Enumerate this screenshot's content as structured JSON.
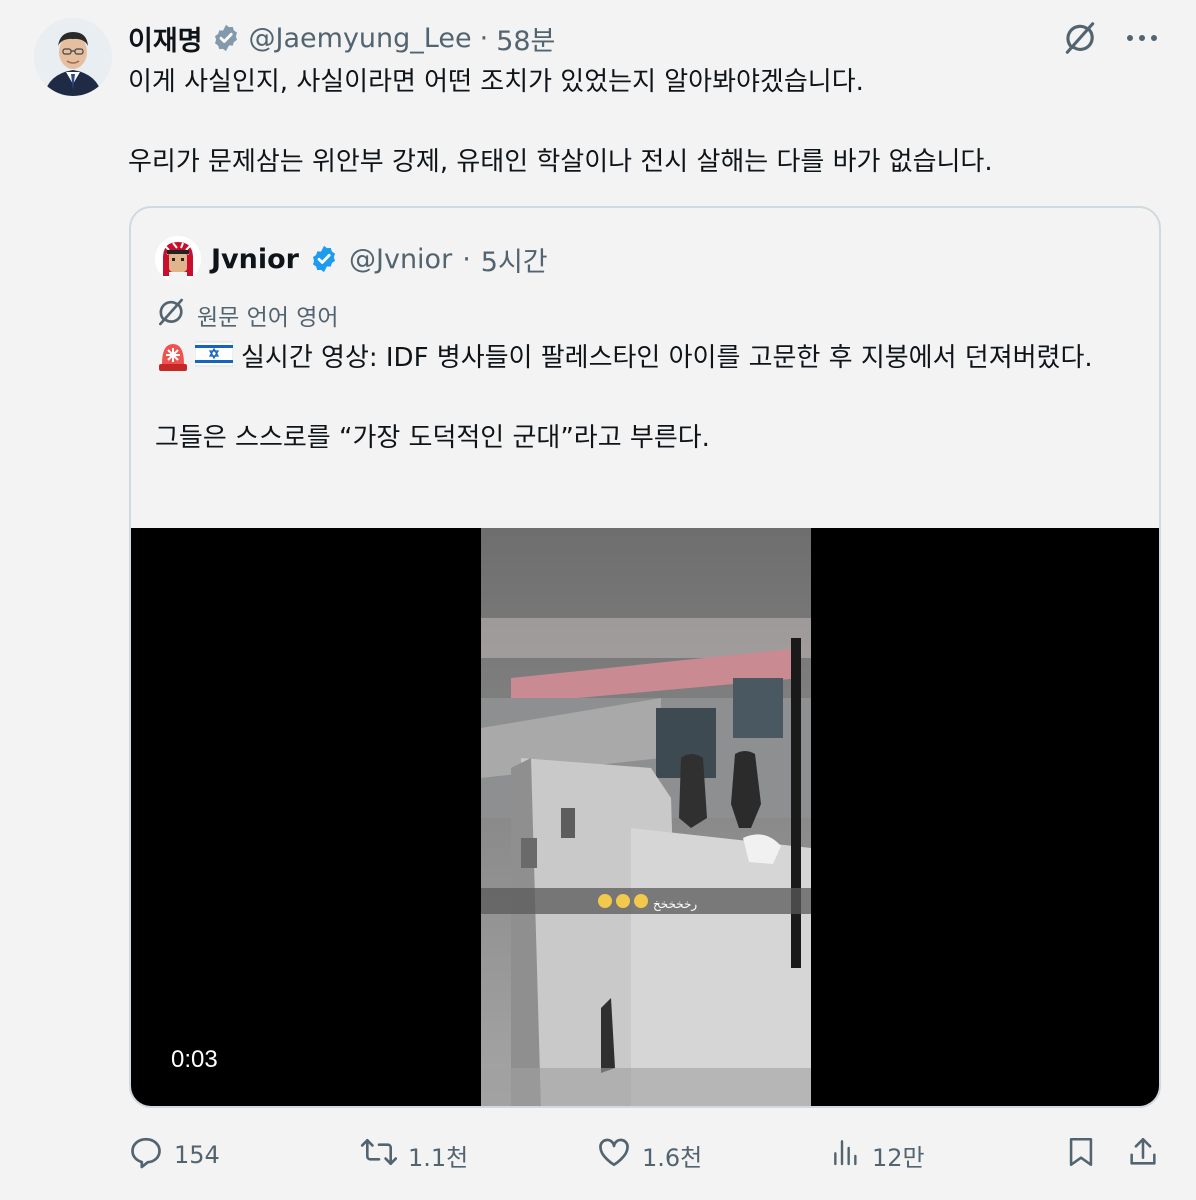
{
  "post": {
    "author_name": "이재명",
    "handle": "@Jaemyung_Lee",
    "separator": "·",
    "time": "58분",
    "text": "이게 사실인지, 사실이라면 어떤 조치가 있었는지 알아봐야겠습니다.\n\n우리가 문제삼는 위안부 강제, 유태인 학살이나 전시 살해는 다를 바가 없습니다."
  },
  "quoted": {
    "author_name": "Jvnior",
    "handle": "@Jvnior",
    "separator": "·",
    "time": "5시간",
    "translate_label": "원문 언어 영어",
    "text": "실시간 영상: IDF 병사들이 팔레스타인 아이를 고문한 후 지붕에서 던져버렸다.\n\n그들은 스스로를 “가장 도덕적인 군대”라고 부른다.",
    "video_duration": "0:03",
    "video_caption_emojis": "😂😂😂",
    "video_caption_text": "رخخخخخ"
  },
  "actions": {
    "replies": "154",
    "reposts": "1.1천",
    "likes": "1.6천",
    "views": "12만"
  },
  "colors": {
    "accent_verified": "#1d9bf0",
    "secondary_text": "#536471",
    "primary_text": "#0f1419"
  }
}
